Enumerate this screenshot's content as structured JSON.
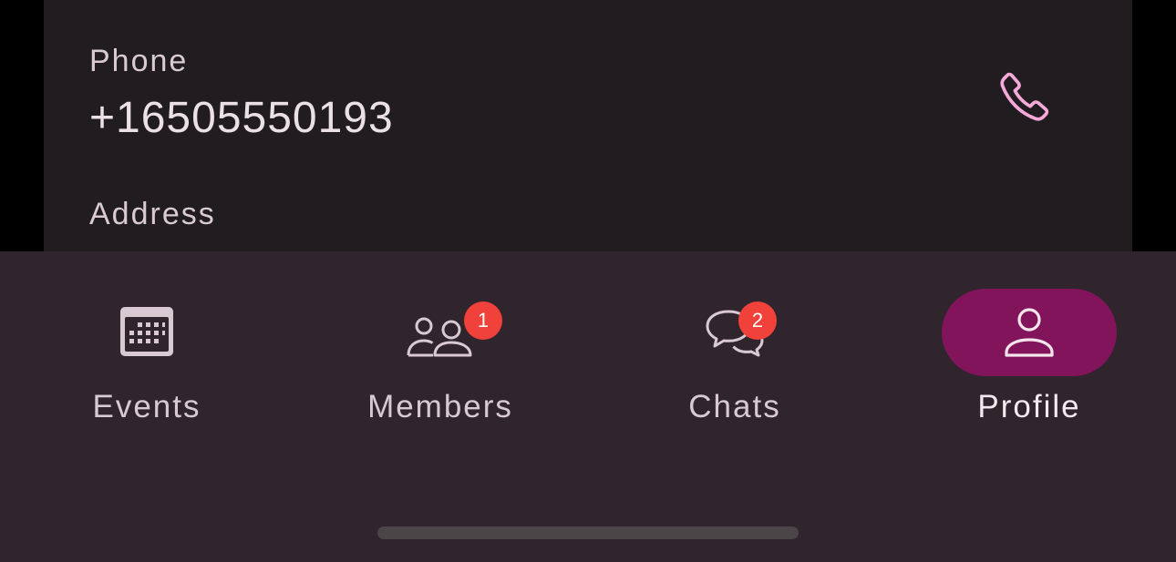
{
  "contact": {
    "phone_label": "Phone",
    "phone_value": "+16505550193",
    "address_label": "Address"
  },
  "nav": {
    "items": [
      {
        "label": "Events",
        "icon": "calendar-icon",
        "badge": null,
        "active": false
      },
      {
        "label": "Members",
        "icon": "people-icon",
        "badge": "1",
        "active": false
      },
      {
        "label": "Chats",
        "icon": "chat-bubbles-icon",
        "badge": "2",
        "active": false
      },
      {
        "label": "Profile",
        "icon": "person-icon",
        "badge": null,
        "active": true
      }
    ]
  },
  "colors": {
    "accent": "#82145c",
    "badge": "#f0413a",
    "call_icon": "#f4a9d8",
    "nav_background": "#31252d",
    "card_background": "#201c1f"
  }
}
